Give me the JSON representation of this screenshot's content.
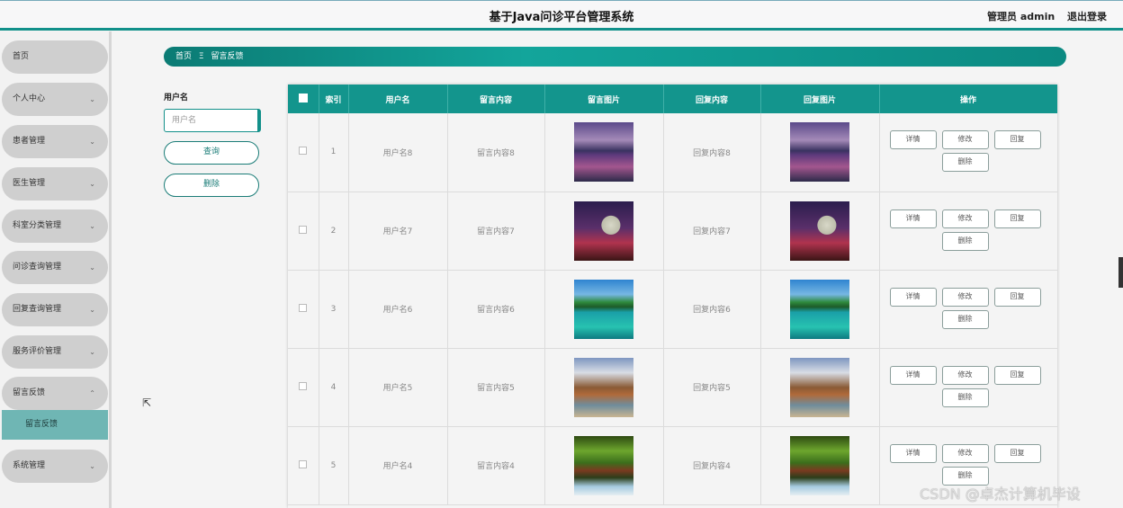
{
  "header": {
    "title": "基于Java问诊平台管理系统",
    "admin_label": "管理员 admin",
    "logout_label": "退出登录"
  },
  "sidebar": {
    "items": [
      {
        "label": "首页",
        "has_chevron": false
      },
      {
        "label": "个人中心",
        "has_chevron": true
      },
      {
        "label": "患者管理",
        "has_chevron": true
      },
      {
        "label": "医生管理",
        "has_chevron": true
      },
      {
        "label": "科室分类管理",
        "has_chevron": true
      },
      {
        "label": "问诊查询管理",
        "has_chevron": true
      },
      {
        "label": "回复查询管理",
        "has_chevron": true
      },
      {
        "label": "服务评价管理",
        "has_chevron": true
      },
      {
        "label": "留言反馈",
        "has_chevron": true,
        "expanded": true
      },
      {
        "label": "系统管理",
        "has_chevron": true
      }
    ],
    "sub_item": "留言反馈"
  },
  "breadcrumb": {
    "home": "首页",
    "separator": "Ξ",
    "current": "留言反馈"
  },
  "search": {
    "label": "用户名",
    "placeholder": "用户名",
    "query_button": "查询",
    "delete_button": "删除"
  },
  "table": {
    "headers": [
      "索引",
      "用户名",
      "留言内容",
      "留言图片",
      "回复内容",
      "回复图片",
      "操作"
    ],
    "rows": [
      {
        "index": "1",
        "username": "用户名8",
        "message": "留言内容8",
        "reply": "回复内容8",
        "image": "img-mtn"
      },
      {
        "index": "2",
        "username": "用户名7",
        "message": "留言内容7",
        "reply": "回复内容7",
        "image": "img-moon"
      },
      {
        "index": "3",
        "username": "用户名6",
        "message": "留言内容6",
        "reply": "回复内容6",
        "image": "img-pier"
      },
      {
        "index": "4",
        "username": "用户名5",
        "message": "留言内容5",
        "reply": "回复内容5",
        "image": "img-arch"
      },
      {
        "index": "5",
        "username": "用户名4",
        "message": "留言内容4",
        "reply": "回复内容4",
        "image": "img-forest"
      }
    ],
    "actions": {
      "detail": "详情",
      "edit": "修改",
      "reply": "回复",
      "delete": "删除"
    }
  },
  "watermark": "CSDN @卓杰计算机毕设",
  "colors": {
    "accent": "#13958d",
    "sidebar_item": "#cfcfcf",
    "sub_item": "#6fb6b4"
  }
}
